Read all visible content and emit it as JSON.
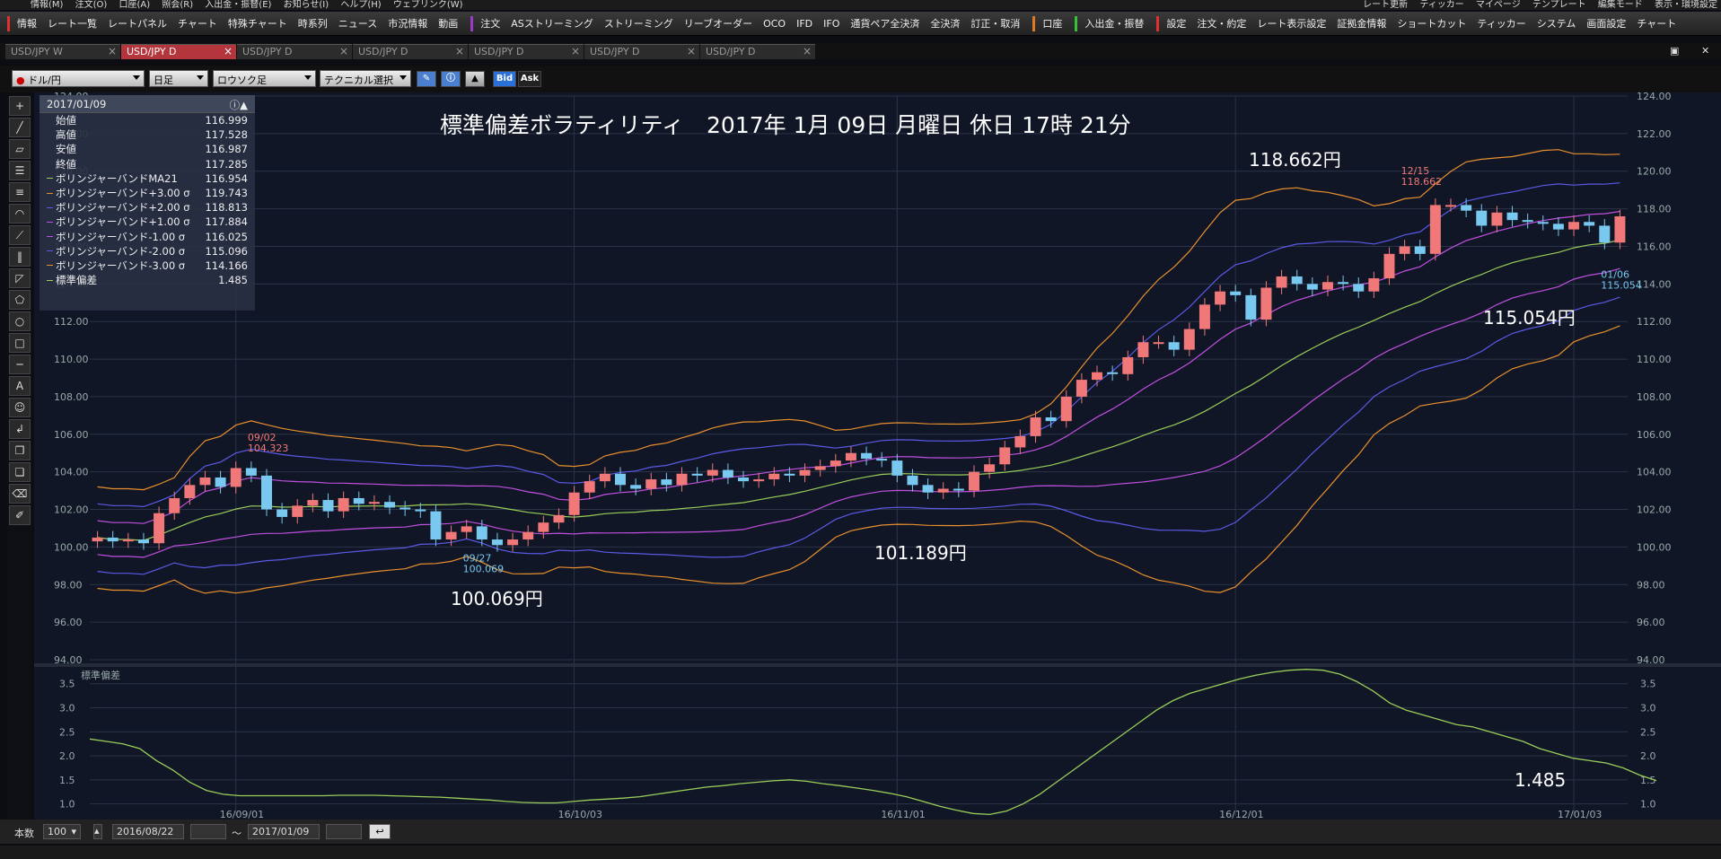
{
  "menubar": {
    "items": [
      "情報(M)",
      "注文(O)",
      "口座(A)",
      "照会(R)",
      "入出金・振替(E)",
      "お知らせ(I)",
      "ヘルプ(H)",
      "ウェブリンク(W)"
    ],
    "right_items": [
      "レート更新",
      "ティッカー",
      "マイページ",
      "テンプレート",
      "編集モード",
      "表示・環境設定"
    ]
  },
  "toolbar": {
    "group1": [
      "情報",
      "レート一覧",
      "レートパネル",
      "チャート",
      "特殊チャート",
      "時系列",
      "ニュース",
      "市況情報",
      "動画"
    ],
    "group2": [
      "注文",
      "ASストリーミング",
      "ストリーミング",
      "リーブオーダー",
      "OCO",
      "IFD",
      "IFO",
      "通貨ペア全決済",
      "全決済",
      "訂正・取消"
    ],
    "group3": [
      "口座"
    ],
    "group4": [
      "入出金・振替"
    ],
    "group5": [
      "設定",
      "注文・約定",
      "レート表示設定",
      "証拠金情報",
      "ショートカット",
      "ティッカー",
      "システム",
      "画面設定",
      "チャート"
    ],
    "colors": {
      "g1": "#e03030",
      "g2": "#9c3ac8",
      "g3": "#e07a20",
      "g4": "#38c038",
      "g5": "#e03030"
    }
  },
  "tabs": [
    {
      "label": "USD/JPY W",
      "active": false
    },
    {
      "label": "USD/JPY D",
      "active": true
    },
    {
      "label": "USD/JPY D",
      "active": false
    },
    {
      "label": "USD/JPY D",
      "active": false
    },
    {
      "label": "USD/JPY D",
      "active": false
    },
    {
      "label": "USD/JPY D",
      "active": false
    },
    {
      "label": "USD/JPY D",
      "active": false
    }
  ],
  "controls": {
    "pair": "ドル/円",
    "period": "日足",
    "chart_style": "ロウソク足",
    "technical": "テクニカル選択",
    "bid": "Bid",
    "ask": "Ask"
  },
  "infobox": {
    "date": "2017/01/09",
    "rows": [
      {
        "label": "始値",
        "value": "116.999",
        "color": ""
      },
      {
        "label": "高値",
        "value": "117.528",
        "color": ""
      },
      {
        "label": "安値",
        "value": "116.987",
        "color": ""
      },
      {
        "label": "終値",
        "value": "117.285",
        "color": ""
      },
      {
        "label": "ボリンジャーバンドMA21",
        "value": "116.954",
        "color": "#9acd5a"
      },
      {
        "label": "ボリンジャーバンド+3.00 σ",
        "value": "119.743",
        "color": "#e8902e"
      },
      {
        "label": "ボリンジャーバンド+2.00 σ",
        "value": "118.813",
        "color": "#5a5ae6"
      },
      {
        "label": "ボリンジャーバンド+1.00 σ",
        "value": "117.884",
        "color": "#c050e0"
      },
      {
        "label": "ボリンジャーバンド-1.00 σ",
        "value": "116.025",
        "color": "#c050e0"
      },
      {
        "label": "ボリンジャーバンド-2.00 σ",
        "value": "115.096",
        "color": "#5a5ae6"
      },
      {
        "label": "ボリンジャーバンド-3.00 σ",
        "value": "114.166",
        "color": "#e8902e"
      },
      {
        "label": "標準偏差",
        "value": "1.485",
        "color": "#9acd5a"
      }
    ]
  },
  "title": "標準偏差ボラティリティ　2017年 1月 09日 月曜日 休日 17時 21分",
  "annotations": {
    "a1": "100.069円",
    "a2": "101.189円",
    "a3": "118.662円",
    "a4": "115.054円",
    "a5": "1.485"
  },
  "chart_data": {
    "type": "candlestick",
    "pair": "USD/JPY",
    "timeframe": "daily",
    "main_panel": {
      "ylim": [
        94.0,
        124.0
      ],
      "y_ticks": [
        "94.00",
        "96.00",
        "98.00",
        "100.00",
        "102.00",
        "104.00",
        "106.00",
        "108.00",
        "110.00",
        "112.00",
        "114.00",
        "116.00",
        "118.00",
        "120.00",
        "122.00",
        "124.00"
      ],
      "x_ticks": [
        "16/09/01",
        "16/10/03",
        "16/11/01",
        "16/12/01",
        "17/01/03"
      ],
      "x_tick_index": [
        9,
        31,
        52,
        74,
        96
      ],
      "n_bars": 100,
      "colors": {
        "up": "#f07878",
        "down": "#78c8f0",
        "ma": "#9acd5a",
        "s1": "#c050e0",
        "s2": "#5a5ae6",
        "s3": "#e8902e"
      },
      "candles_close": [
        100.5,
        100.3,
        100.4,
        100.2,
        101.8,
        102.6,
        103.3,
        103.7,
        103.2,
        104.2,
        103.8,
        102.0,
        101.6,
        102.2,
        102.5,
        101.9,
        102.6,
        102.3,
        102.4,
        102.1,
        102.0,
        101.9,
        100.4,
        100.8,
        101.1,
        100.4,
        100.1,
        100.4,
        100.8,
        101.3,
        101.7,
        102.9,
        103.5,
        103.9,
        103.3,
        103.1,
        103.6,
        103.3,
        103.9,
        103.8,
        104.1,
        103.7,
        103.5,
        103.6,
        103.9,
        103.8,
        104.1,
        104.3,
        104.6,
        105.0,
        104.7,
        104.6,
        103.8,
        103.3,
        102.9,
        103.1,
        103.0,
        104.0,
        104.4,
        105.3,
        105.9,
        106.9,
        106.7,
        108.0,
        108.9,
        109.3,
        109.2,
        110.1,
        110.9,
        110.9,
        110.5,
        111.6,
        112.9,
        113.6,
        113.4,
        112.1,
        113.8,
        114.4,
        114.0,
        113.7,
        114.1,
        114.0,
        113.6,
        114.3,
        115.6,
        116.0,
        115.6,
        118.2,
        118.2,
        117.9,
        117.1,
        117.8,
        117.4,
        117.3,
        117.2,
        116.9,
        117.3,
        117.1,
        116.2,
        117.6,
        117.0,
        115.3,
        117.3
      ],
      "bollinger": {
        "ma_start": 102.0,
        "ma_end": 116.95,
        "s_plus3_end": 119.743,
        "s_plus2_end": 118.813,
        "s_plus1_end": 117.884,
        "s_minus1_end": 116.025,
        "s_minus2_end": 115.096,
        "s_minus3_end": 114.166
      },
      "labels": [
        {
          "date": "09/02",
          "price": "104.323",
          "color": "#f07878"
        },
        {
          "date": "09/27",
          "price": "100.069",
          "color": "#78c8f0"
        },
        {
          "date": "12/15",
          "price": "118.662",
          "color": "#f07878"
        },
        {
          "date": "01/06",
          "price": "115.054",
          "color": "#78c8f0"
        }
      ]
    },
    "sub_panel": {
      "title": "標準偏差",
      "ylim": [
        0.75,
        3.85
      ],
      "y_ticks": [
        "1.0",
        "1.5",
        "2.0",
        "2.5",
        "3.0",
        "3.5"
      ],
      "values": [
        2.35,
        2.3,
        2.25,
        2.15,
        1.9,
        1.7,
        1.45,
        1.28,
        1.2,
        1.17,
        1.17,
        1.17,
        1.17,
        1.17,
        1.17,
        1.18,
        1.18,
        1.18,
        1.17,
        1.16,
        1.15,
        1.14,
        1.12,
        1.1,
        1.08,
        1.05,
        1.03,
        1.02,
        1.02,
        1.05,
        1.08,
        1.1,
        1.12,
        1.15,
        1.2,
        1.25,
        1.3,
        1.35,
        1.38,
        1.42,
        1.45,
        1.48,
        1.5,
        1.47,
        1.42,
        1.38,
        1.33,
        1.28,
        1.22,
        1.15,
        1.05,
        0.95,
        0.87,
        0.8,
        0.78,
        0.85,
        1.0,
        1.2,
        1.45,
        1.7,
        1.95,
        2.2,
        2.45,
        2.7,
        2.95,
        3.15,
        3.3,
        3.4,
        3.5,
        3.6,
        3.68,
        3.74,
        3.78,
        3.8,
        3.78,
        3.7,
        3.55,
        3.35,
        3.1,
        2.95,
        2.85,
        2.75,
        2.65,
        2.6,
        2.5,
        2.4,
        2.3,
        2.15,
        2.05,
        1.95,
        1.9,
        1.85,
        1.75,
        1.6,
        1.485
      ],
      "color": "#9acd5a"
    }
  },
  "bottombar": {
    "count_label": "本数",
    "count": "100",
    "from": "2016/08/22",
    "sep": "～",
    "to": "2017/01/09"
  }
}
